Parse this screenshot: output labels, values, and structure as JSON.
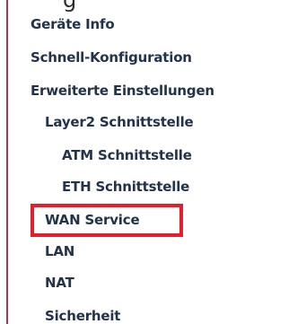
{
  "top_fragment": "g",
  "menu": {
    "items": [
      {
        "label": "Geräte Info"
      },
      {
        "label": "Schnell-Konfiguration"
      },
      {
        "label": "Erweiterte Einstellungen"
      },
      {
        "label": "Layer2 Schnittstelle"
      },
      {
        "label": "ATM Schnittstelle"
      },
      {
        "label": "ETH Schnittstelle"
      },
      {
        "label": "WAN Service"
      },
      {
        "label": "LAN"
      },
      {
        "label": "NAT"
      },
      {
        "label": "Sicherheit"
      }
    ]
  },
  "colors": {
    "text": "#22334a",
    "left_border": "#a23a4a",
    "highlight": "#e41f2b"
  }
}
